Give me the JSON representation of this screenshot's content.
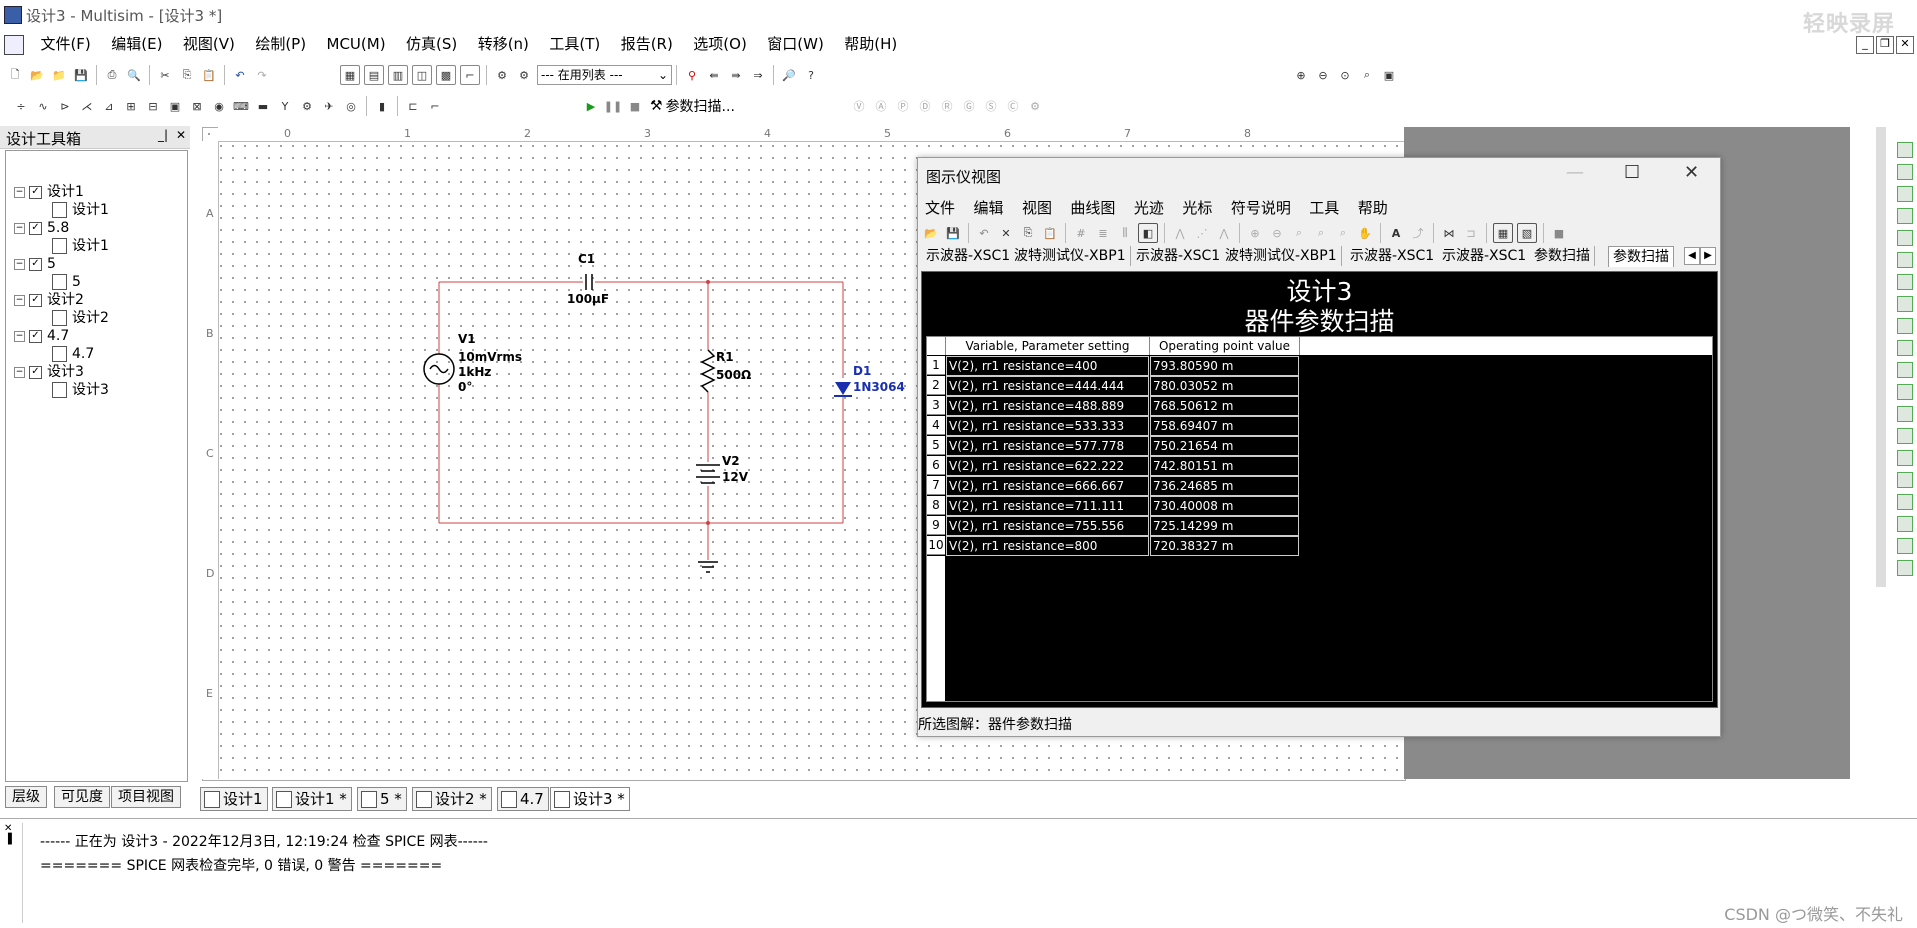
{
  "window": {
    "title": "设计3 - Multisim - [设计3 *]",
    "watermark": "轻映录屏"
  },
  "menu": [
    "文件(F)",
    "编辑(E)",
    "视图(V)",
    "绘制(P)",
    "MCU(M)",
    "仿真(S)",
    "转移(n)",
    "工具(T)",
    "报告(R)",
    "选项(O)",
    "窗口(W)",
    "帮助(H)"
  ],
  "toolbar": {
    "in_use_list": "--- 在用列表 ---",
    "param_sweep": "参数扫描..."
  },
  "left_panel": {
    "title": "设计工具箱",
    "tree": [
      {
        "label": "设计1",
        "level": 0,
        "child": "设计1"
      },
      {
        "label": "5.8",
        "level": 0,
        "child": "设计1"
      },
      {
        "label": "5",
        "level": 0,
        "child": "5"
      },
      {
        "label": "设计2",
        "level": 0,
        "child": "设计2"
      },
      {
        "label": "4.7",
        "level": 0,
        "child": "4.7"
      },
      {
        "label": "设计3",
        "level": 0,
        "child": "设计3"
      }
    ],
    "tabs": [
      "层级",
      "可见度",
      "项目视图"
    ]
  },
  "ruler": {
    "h": [
      "0",
      "1",
      "2",
      "3",
      "4",
      "5",
      "6",
      "7",
      "8"
    ],
    "v": [
      "A",
      "B",
      "C",
      "D",
      "E"
    ]
  },
  "schematic": {
    "c1_name": "C1",
    "c1_value": "100µF",
    "v1_name": "V1",
    "v1_value1": "10mVrms",
    "v1_value2": "1kHz",
    "v1_value3": "0°",
    "r1_name": "R1",
    "r1_value": "500Ω",
    "v2_name": "V2",
    "v2_value": "12V",
    "d1_name": "D1",
    "d1_value": "1N3064"
  },
  "grapher": {
    "title": "图示仪视图",
    "menu": [
      "文件",
      "编辑",
      "视图",
      "曲线图",
      "光迹",
      "光标",
      "符号说明",
      "工具",
      "帮助"
    ],
    "tabs": [
      "示波器-XSC1",
      "波特测试仪-XBP1",
      "示波器-XSC1",
      "波特测试仪-XBP1",
      "示波器-XSC1",
      "示波器-XSC1",
      "参数扫描",
      "参数扫描"
    ],
    "plot_title": "设计3",
    "plot_subtitle": "器件参数扫描",
    "columns": [
      "Variable, Parameter setting",
      "Operating point value"
    ],
    "rows": [
      {
        "idx": "1",
        "var": "V(2), rr1 resistance=400",
        "val": "793.80590 m"
      },
      {
        "idx": "2",
        "var": "V(2), rr1 resistance=444.444",
        "val": "780.03052 m"
      },
      {
        "idx": "3",
        "var": "V(2), rr1 resistance=488.889",
        "val": "768.50612 m"
      },
      {
        "idx": "4",
        "var": "V(2), rr1 resistance=533.333",
        "val": "758.69407 m"
      },
      {
        "idx": "5",
        "var": "V(2), rr1 resistance=577.778",
        "val": "750.21654 m"
      },
      {
        "idx": "6",
        "var": "V(2), rr1 resistance=622.222",
        "val": "742.80151 m"
      },
      {
        "idx": "7",
        "var": "V(2), rr1 resistance=666.667",
        "val": "736.24685 m"
      },
      {
        "idx": "8",
        "var": "V(2), rr1 resistance=711.111",
        "val": "730.40008 m"
      },
      {
        "idx": "9",
        "var": "V(2), rr1 resistance=755.556",
        "val": "725.14299 m"
      },
      {
        "idx": "10",
        "var": "V(2), rr1 resistance=800",
        "val": "720.38327 m"
      }
    ],
    "status": "所选图解：器件参数扫描"
  },
  "bottom_tabs": [
    "设计1",
    "设计1 *",
    "5 *",
    "设计2 *",
    "4.7",
    "设计3 *"
  ],
  "output": {
    "line1": "------ 正在为 设计3 - 2022年12月3日, 12:19:24 检查 SPICE 网表------",
    "line2": "======= SPICE 网表检查完毕, 0 错误, 0 警告 =======",
    "watermark": "CSDN @つ微笑、不失礼"
  }
}
